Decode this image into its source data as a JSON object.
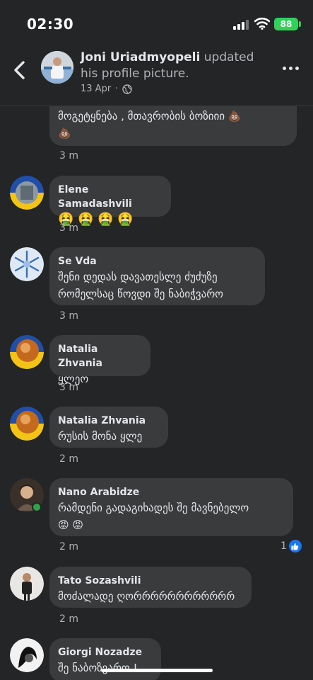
{
  "status_bar": {
    "time": "02:30",
    "battery": "88"
  },
  "header": {
    "name": "Joni Uriadmyopeli",
    "action": " updated his profile picture.",
    "date": "13 Apr",
    "audience_icon": "globe-icon",
    "back_icon": "chevron-left-icon",
    "more_icon": "more-dots-icon"
  },
  "comments": [
    {
      "author": "",
      "text": "მოგეტყნება  ,  მთავრობის ბოზიიი 💩\n💩",
      "time": "3 m"
    },
    {
      "author": "Elene Samadashvili",
      "text": "🤮 🤮 🤮 🤮",
      "time": "3 m"
    },
    {
      "author": "Se Vda",
      "text": "შენი დედას დავათესლე ძუძუზე\nრომელსაც წოვდი შე ნაბიჭვარო",
      "time": "3 m"
    },
    {
      "author": "Natalia Zhvania",
      "text": "ყლეო",
      "time": "3 m"
    },
    {
      "author": "Natalia Zhvania",
      "text": "რუსის მონა ყლე",
      "time": "2 m"
    },
    {
      "author": "Nano Arabidze",
      "text": "რამდენი გადაგიხადეს შე მავნებელო\n😡 😡",
      "time": "2 m",
      "likes": "1"
    },
    {
      "author": "Tato Sozashvili",
      "text": "მოძალადე ღორრრრრრრრრრრრ",
      "time": "2 m"
    },
    {
      "author": "Giorgi Nozadze",
      "text": "შე ნაბოზვარო !",
      "time": ""
    }
  ],
  "colors": {
    "background": "#242526",
    "bubble": "#3a3b3c",
    "like_blue": "#1877f2",
    "online_green": "#31a24c",
    "battery_green": "#30d158"
  }
}
